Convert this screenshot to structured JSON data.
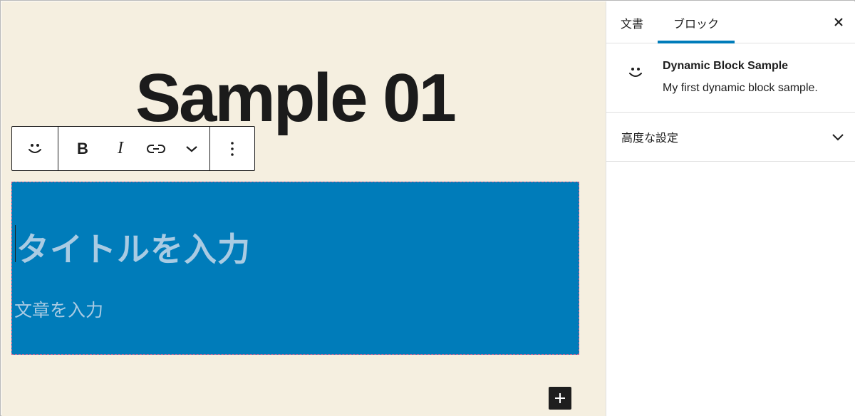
{
  "editor": {
    "page_title": "Sample 01",
    "toolbar": {
      "block_icon": "smiley-icon",
      "buttons": [
        "bold-icon",
        "italic-icon",
        "link-icon",
        "chevron-down-icon"
      ],
      "bold_label": "B",
      "italic_label": "I",
      "more_icon": "more-vertical-icon"
    },
    "block": {
      "heading_placeholder": "タイトルを入力",
      "text_placeholder": "文章を入力",
      "background_color": "#007cba"
    },
    "inserter_icon": "plus-icon"
  },
  "sidebar": {
    "tabs": [
      {
        "label": "文書",
        "active": false
      },
      {
        "label": "ブロック",
        "active": true
      }
    ],
    "close_icon": "close-icon",
    "block_card": {
      "icon": "smiley-icon",
      "title": "Dynamic Block Sample",
      "description": "My first dynamic block sample."
    },
    "panels": [
      {
        "title": "高度な設定",
        "expanded": false
      }
    ]
  },
  "colors": {
    "canvas_background": "#f5efe0",
    "accent": "#007cba"
  }
}
